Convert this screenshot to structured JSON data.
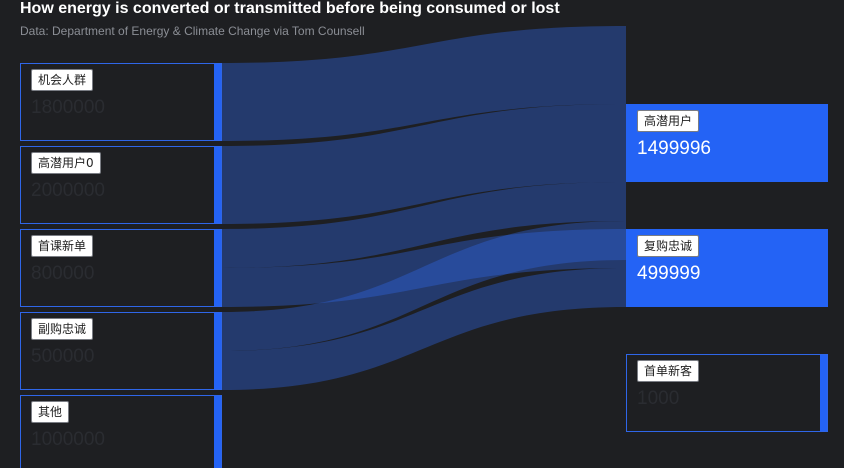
{
  "title": "How energy is converted or transmitted before being consumed or lost",
  "subtitle": "Data: Department of Energy & Climate Change via Tom Counsell",
  "colors": {
    "background": "#1e1f22",
    "node": "#2463f5",
    "link": "#2f66e8",
    "tag_bg": "#ffffff"
  },
  "chart_data": {
    "type": "sankey",
    "sources": [
      {
        "id": "s0",
        "label": "机会人群",
        "value": "1800000"
      },
      {
        "id": "s1",
        "label": "高潜用户0",
        "value": "2000000"
      },
      {
        "id": "s2",
        "label": "首课新单",
        "value": "800000"
      },
      {
        "id": "s3",
        "label": "副购忠诚",
        "value": "500000"
      },
      {
        "id": "s4",
        "label": "其他",
        "value": "1000000"
      }
    ],
    "targets": [
      {
        "id": "t0",
        "label": "高潜用户",
        "value": "1499996",
        "highlight": true
      },
      {
        "id": "t1",
        "label": "复购忠诚",
        "value": "499999",
        "highlight": true
      },
      {
        "id": "t2",
        "label": "首单新客",
        "value": "1000",
        "highlight": false
      }
    ],
    "links": [
      {
        "source": "s0",
        "target": "t0",
        "value": 500000
      },
      {
        "source": "s1",
        "target": "t0",
        "value": 499998
      },
      {
        "source": "s2",
        "target": "t0",
        "value": 249999
      },
      {
        "source": "s2",
        "target": "t1",
        "value": 249999
      },
      {
        "source": "s3",
        "target": "t0",
        "value": 249999
      },
      {
        "source": "s3",
        "target": "t1",
        "value": 250000
      }
    ]
  }
}
